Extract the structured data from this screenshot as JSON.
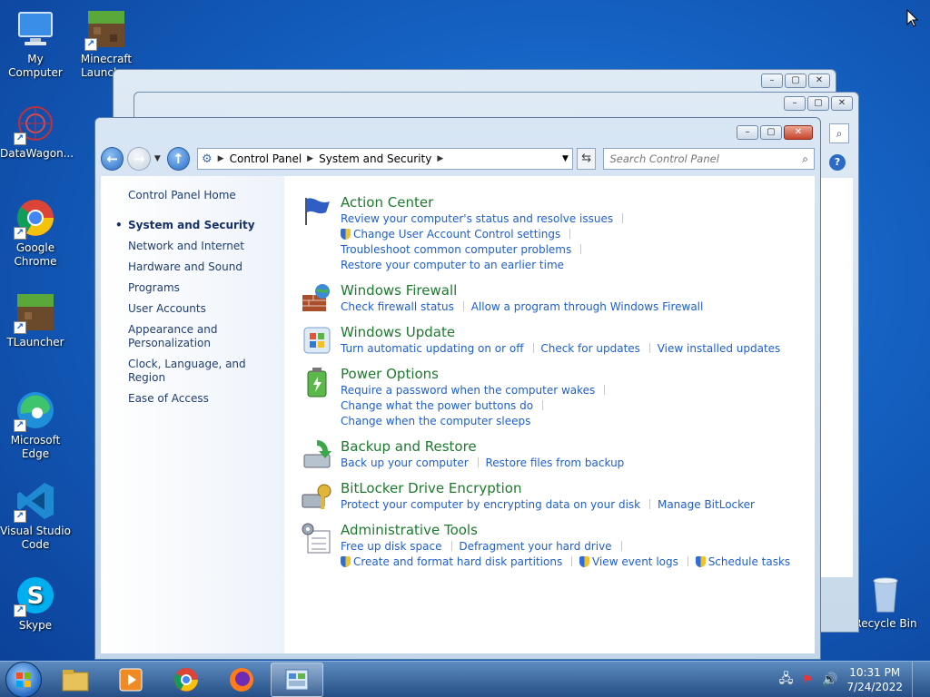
{
  "desktop": {
    "icons": [
      {
        "label": "My Computer"
      },
      {
        "label": "Minecraft Launcher"
      },
      {
        "label": "DataWagon..."
      },
      {
        "label": "Google Chrome"
      },
      {
        "label": "TLauncher"
      },
      {
        "label": "Microsoft Edge"
      },
      {
        "label": "Visual Studio Code"
      },
      {
        "label": "Skype"
      },
      {
        "label": "Recycle Bin"
      }
    ]
  },
  "window": {
    "breadcrumb": [
      "Control Panel",
      "System and Security"
    ],
    "search_placeholder": "Search Control Panel",
    "left_nav": {
      "home": "Control Panel Home",
      "items": [
        "System and Security",
        "Network and Internet",
        "Hardware and Sound",
        "Programs",
        "User Accounts",
        "Appearance and Personalization",
        "Clock, Language, and Region",
        "Ease of Access"
      ]
    },
    "categories": [
      {
        "title": "Action Center",
        "links": [
          "Review your computer's status and resolve issues",
          "Change User Account Control settings",
          "Troubleshoot common computer problems",
          "Restore your computer to an earlier time"
        ]
      },
      {
        "title": "Windows Firewall",
        "links": [
          "Check firewall status",
          "Allow a program through Windows Firewall"
        ]
      },
      {
        "title": "Windows Update",
        "links": [
          "Turn automatic updating on or off",
          "Check for updates",
          "View installed updates"
        ]
      },
      {
        "title": "Power Options",
        "links": [
          "Require a password when the computer wakes",
          "Change what the power buttons do",
          "Change when the computer sleeps"
        ]
      },
      {
        "title": "Backup and Restore",
        "links": [
          "Back up your computer",
          "Restore files from backup"
        ]
      },
      {
        "title": "BitLocker Drive Encryption",
        "links": [
          "Protect your computer by encrypting data on your disk",
          "Manage BitLocker"
        ]
      },
      {
        "title": "Administrative Tools",
        "links": [
          "Free up disk space",
          "Defragment your hard drive",
          "Create and format hard disk partitions",
          "View event logs",
          "Schedule tasks"
        ]
      }
    ]
  },
  "taskbar": {
    "time": "10:31 PM",
    "date": "7/24/2022"
  }
}
